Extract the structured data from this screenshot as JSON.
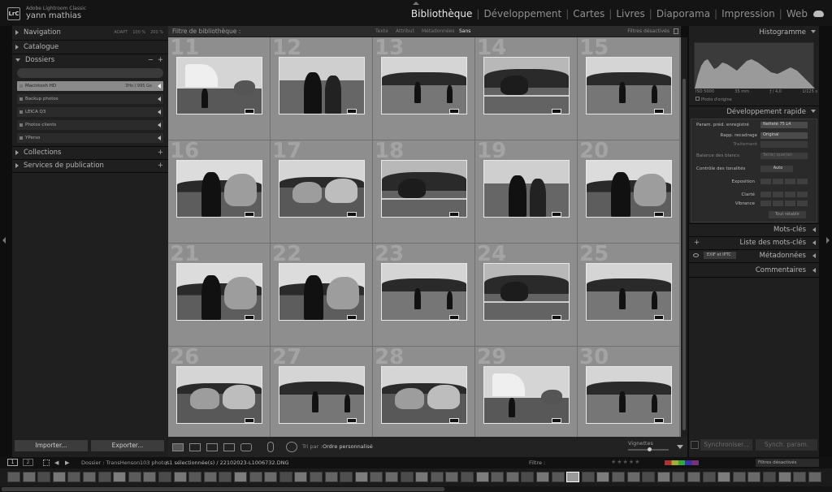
{
  "app": {
    "logo": "LrC",
    "name": "Adobe Lightroom Classic",
    "user": "yann mathias"
  },
  "modules": [
    {
      "label": "Bibliothèque",
      "active": true
    },
    {
      "label": "Développement",
      "active": false
    },
    {
      "label": "Cartes",
      "active": false
    },
    {
      "label": "Livres",
      "active": false
    },
    {
      "label": "Diaporama",
      "active": false
    },
    {
      "label": "Impression",
      "active": false
    },
    {
      "label": "Web",
      "active": false
    }
  ],
  "left_panel": {
    "navigation": {
      "label": "Navigation",
      "zoom": [
        "ADAPT",
        "100 %",
        "200 %"
      ]
    },
    "catalogue": {
      "label": "Catalogue"
    },
    "dossiers": {
      "label": "Dossiers",
      "minus": "−",
      "plus": "+"
    },
    "folders": [
      {
        "label": "Macintosh HD",
        "size": "3Ho / 995 Go",
        "selected": true
      },
      {
        "label": "Backup photos",
        "size": "",
        "selected": false
      },
      {
        "label": "LEICA Q3",
        "size": "",
        "selected": false
      },
      {
        "label": "Photos clients",
        "size": "",
        "selected": false
      },
      {
        "label": "YPerso",
        "size": "",
        "selected": false
      }
    ],
    "collections": {
      "label": "Collections",
      "plus": "+"
    },
    "publish": {
      "label": "Services de publication",
      "plus": "+"
    },
    "import_label": "Importer...",
    "export_label": "Exporter..."
  },
  "filter_bar": {
    "title": "Filtre de bibliothèque :",
    "tabs": [
      "Texte",
      "Attribut",
      "Métadonnées",
      "Sans"
    ],
    "status": "Filtres désactivés"
  },
  "grid": {
    "cells": [
      {
        "num": "11",
        "scene": "tent"
      },
      {
        "num": "12",
        "scene": "couple"
      },
      {
        "num": "13",
        "scene": "field"
      },
      {
        "num": "14",
        "scene": "fence"
      },
      {
        "num": "15",
        "scene": "field"
      },
      {
        "num": "16",
        "scene": "rider"
      },
      {
        "num": "17",
        "scene": "horse"
      },
      {
        "num": "18",
        "scene": "fence"
      },
      {
        "num": "19",
        "scene": "couple"
      },
      {
        "num": "20",
        "scene": "rider"
      },
      {
        "num": "21",
        "scene": "rider"
      },
      {
        "num": "22",
        "scene": "rider"
      },
      {
        "num": "23",
        "scene": "field"
      },
      {
        "num": "24",
        "scene": "fence"
      },
      {
        "num": "25",
        "scene": "field"
      },
      {
        "num": "26",
        "scene": "horse"
      },
      {
        "num": "27",
        "scene": "field"
      },
      {
        "num": "28",
        "scene": "horse"
      },
      {
        "num": "29",
        "scene": "tent"
      },
      {
        "num": "30",
        "scene": "field"
      }
    ]
  },
  "toolbar": {
    "sort_label": "Tri par :",
    "sort_value": "Ordre personnalisé",
    "thumbnails_label": "Vignettes"
  },
  "right_panel": {
    "histogram": {
      "label": "Histogramme",
      "iso": "ISO 5000",
      "focal": "35 mm",
      "aperture": "ƒ / 4,0",
      "shutter": "1/125 s",
      "original": "Photo d'origine"
    },
    "quick_develop": {
      "label": "Développement rapide",
      "preset_label": "Param. préd. enregistré",
      "preset_value": "Netteté 75 L4",
      "crop_label": "Rapp. recadrage",
      "crop_value": "Original",
      "treatment_label": "Traitement",
      "wb_label": "Balance des blancs",
      "wb_value": "Tel(le) quel(le)",
      "tone_label": "Contrôle des tonalités",
      "auto_label": "Auto",
      "exposure_label": "Exposition",
      "clarity_label": "Clarté",
      "vibrance_label": "Vibrance",
      "reset_label": "Tout rétablir"
    },
    "keywords": {
      "label": "Mots-clés"
    },
    "keyword_list": {
      "label": "Liste des mots-clés",
      "plus": "+"
    },
    "metadata": {
      "label": "Métadonnées",
      "preset": "EXIF et IPTC"
    },
    "comments": {
      "label": "Commentaires"
    },
    "sync_label": "Synchroniser...",
    "sync_params_label": "Synch. param."
  },
  "info_bar": {
    "pages": [
      "1",
      "2"
    ],
    "folder": "Dossier : TransHenson",
    "count": "103 photos",
    "selection": "/ 1 sélectionnée(s) / 22102023-L1006732.DNG",
    "filter_label": "Filtre :",
    "filter_status": "Filtres désactivés"
  },
  "colors": {
    "accent": "#e8e8e8",
    "panel": "#1f1f1f",
    "grid": "#7b7b7b",
    "cell": "#8e8e8e"
  }
}
